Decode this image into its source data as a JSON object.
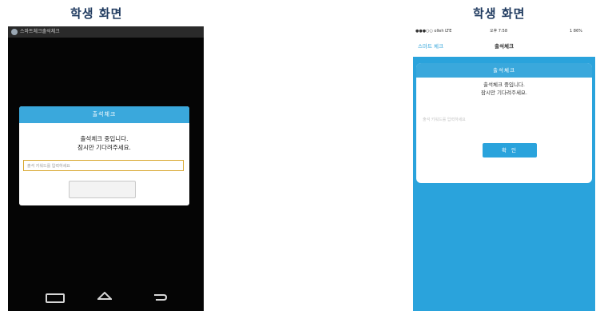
{
  "captions": {
    "left": "학생 화면",
    "right": "학생 화면"
  },
  "android": {
    "status_title": "스마트체크출석체크",
    "dialog_title": "출석체크",
    "message_line1": "출석체크 중입니다.",
    "message_line2": "잠시만 기다려주세요.",
    "input_placeholder": "출석 키워드를 입력하세요",
    "accent_color": "#3aa8dc"
  },
  "iphone": {
    "status_carrier": "●●●○○ olleh LTE",
    "status_time": "오후 7:58",
    "status_battery": "1 86%",
    "nav_back": "스마트 체크",
    "nav_title": "출석체크",
    "card_title": "출석체크",
    "message_line1": "출석체크 중입니다.",
    "message_line2": "잠시만 기다려주세요.",
    "input_placeholder": "출석 키워드를 입력하세요",
    "confirm_label": "확 인",
    "accent_color": "#2aa3dc"
  },
  "icons": [
    "back-icon",
    "home-icon",
    "recent-apps-icon",
    "app-icon"
  ]
}
